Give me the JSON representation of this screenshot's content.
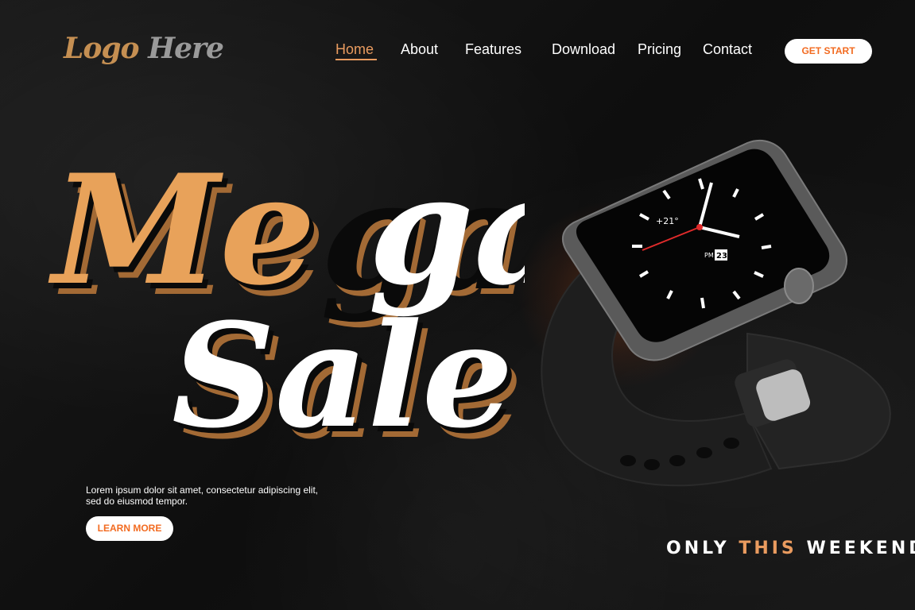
{
  "logo": {
    "part1": "Logo",
    "part2": "Here"
  },
  "nav": {
    "items": [
      {
        "label": "Home",
        "active": true
      },
      {
        "label": "About"
      },
      {
        "label": "Features"
      },
      {
        "label": "Download"
      },
      {
        "label": "Pricing"
      },
      {
        "label": "Contact"
      }
    ],
    "cta_label": "GET START"
  },
  "hero": {
    "headline_line1": "Mega",
    "headline_line2": "Sale",
    "description_line1": "Lorem ipsum dolor sit amet, consectetur adipiscing elit,",
    "description_line2": "sed do eiusmod tempor.",
    "cta_label": "LEARN MORE",
    "tagline_part1": "ONLY",
    "tagline_highlight": "THIS",
    "tagline_part2": "WEEKEND"
  },
  "watch": {
    "temperature": "+21°",
    "am_pm": "PM",
    "date": "23"
  },
  "colors": {
    "accent": "#e99b5f",
    "headline_orange": "#e8a25a",
    "button_text": "#f26b21",
    "background": "#121212"
  }
}
